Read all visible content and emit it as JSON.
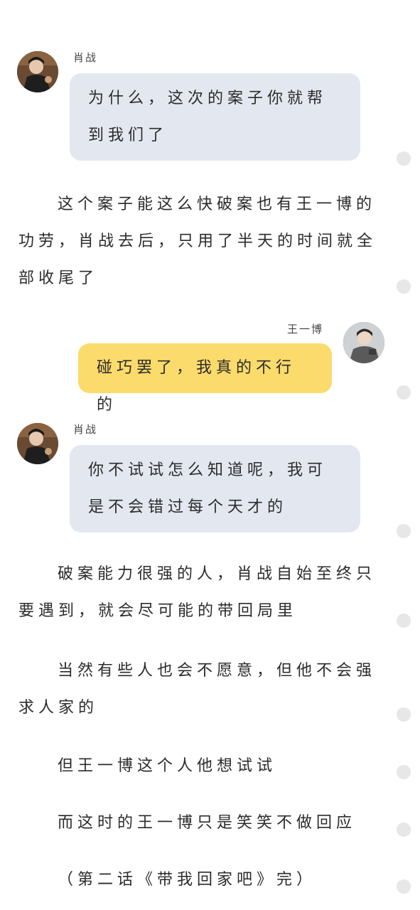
{
  "messages": [
    {
      "speaker": "肖战",
      "text": "为什么，这次的案子你就帮到我们了"
    },
    {
      "speaker": "王一博",
      "text": "碰巧罢了，我真的不行的"
    },
    {
      "speaker": "肖战",
      "text": "你不试试怎么知道呢，我可是不会错过每个天才的"
    }
  ],
  "paragraphs": [
    "这个案子能这么快破案也有王一博的功劳，肖战去后，只用了半天的时间就全部收尾了",
    "破案能力很强的人，肖战自始至终只要遇到，就会尽可能的带回局里",
    "当然有些人也会不愿意，但他不会强求人家的",
    "但王一博这个人他想试试",
    "而这时的王一博只是笑笑不做回应",
    "（第二话《带我回家吧》完）"
  ],
  "colors": {
    "bubble_gray": "#e3e8f0",
    "bubble_yellow": "#fbdb6b",
    "side_dot": "#e7e7e7"
  }
}
